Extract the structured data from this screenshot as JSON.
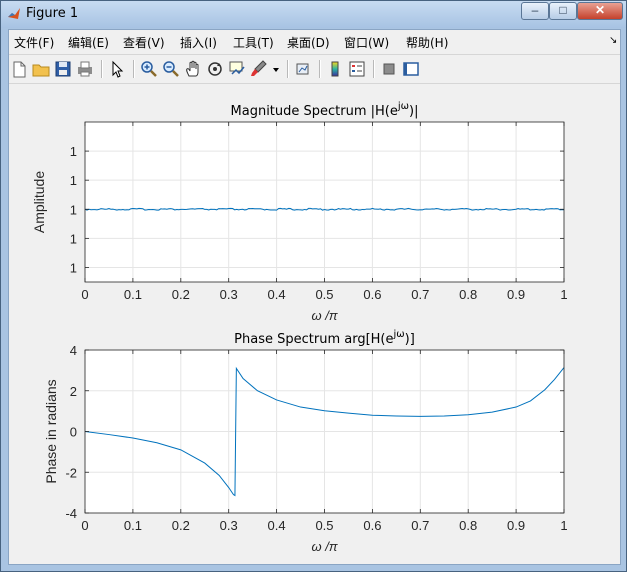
{
  "window": {
    "title": "Figure 1",
    "controls": {
      "minimize": "–",
      "maximize": "□",
      "close": "✕"
    }
  },
  "menu": {
    "items": [
      "文件(F)",
      "编辑(E)",
      "查看(V)",
      "插入(I)",
      "工具(T)",
      "桌面(D)",
      "窗口(W)",
      "帮助(H)"
    ],
    "overflow": "↘"
  },
  "toolbar": {
    "buttons": [
      "new-figure-icon",
      "open-file-icon",
      "save-icon",
      "print-icon",
      "pointer-icon",
      "zoom-in-icon",
      "zoom-out-icon",
      "pan-hand-icon",
      "rotate-3d-icon",
      "data-cursor-icon",
      "brush-icon",
      "brush-dropdown-icon",
      "link-plot-icon",
      "colorbar-icon",
      "legend-icon",
      "hide-plot-tools-icon",
      "show-plot-tools-icon"
    ]
  },
  "colors": {
    "line": "#0072bd",
    "grid": "#e5e5e5",
    "axes": "#262626",
    "background": "#f0f0f0"
  },
  "chart_data": [
    {
      "type": "line",
      "title_main": "Magnitude Spectrum |H(e",
      "title_sup": "jω",
      "title_end": ")|",
      "xlabel": "ω /π",
      "ylabel": "Amplitude",
      "xlim": [
        0,
        1
      ],
      "ylim": [
        0.9999999999999994,
        1.0000000000000007
      ],
      "xticks": [
        0,
        0.1,
        0.2,
        0.3,
        0.4,
        0.5,
        0.6,
        0.7,
        0.8,
        0.9,
        1
      ],
      "xtick_labels": [
        "0",
        "0.1",
        "0.2",
        "0.3",
        "0.4",
        "0.5",
        "0.6",
        "0.7",
        "0.8",
        "0.9",
        "1"
      ],
      "yticks": [
        0.9999999999999996,
        0.9999999999999998,
        1.0,
        1.0000000000000002,
        1.0000000000000004
      ],
      "ytick_labels": [
        "1",
        "1",
        "1",
        "1",
        "1"
      ],
      "grid": true,
      "series": [
        {
          "x": [
            0,
            1
          ],
          "y": [
            1.0,
            1.0
          ]
        }
      ]
    },
    {
      "type": "line",
      "title_main": "Phase Spectrum arg[H(e",
      "title_sup": "jω",
      "title_end": ")]",
      "xlabel": "ω /π",
      "ylabel": "Phase in radians",
      "xlim": [
        0,
        1
      ],
      "ylim": [
        -4,
        4
      ],
      "xticks": [
        0,
        0.1,
        0.2,
        0.3,
        0.4,
        0.5,
        0.6,
        0.7,
        0.8,
        0.9,
        1
      ],
      "xtick_labels": [
        "0",
        "0.1",
        "0.2",
        "0.3",
        "0.4",
        "0.5",
        "0.6",
        "0.7",
        "0.8",
        "0.9",
        "1"
      ],
      "yticks": [
        -4,
        -2,
        0,
        2,
        4
      ],
      "ytick_labels": [
        "-4",
        "-2",
        "0",
        "2",
        "4"
      ],
      "grid": true,
      "series": [
        {
          "x": [
            0,
            0.05,
            0.1,
            0.15,
            0.2,
            0.25,
            0.28,
            0.3,
            0.31,
            0.313,
            0.316,
            0.33,
            0.36,
            0.4,
            0.45,
            0.5,
            0.55,
            0.6,
            0.65,
            0.7,
            0.75,
            0.8,
            0.85,
            0.9,
            0.93,
            0.96,
            0.98,
            1.0
          ],
          "y": [
            0,
            -0.15,
            -0.32,
            -0.55,
            -0.9,
            -1.55,
            -2.15,
            -2.75,
            -3.1,
            -3.14,
            3.1,
            2.6,
            2.0,
            1.55,
            1.2,
            1.02,
            0.9,
            0.8,
            0.76,
            0.74,
            0.76,
            0.82,
            0.95,
            1.2,
            1.5,
            2.05,
            2.55,
            3.14
          ]
        }
      ]
    }
  ]
}
